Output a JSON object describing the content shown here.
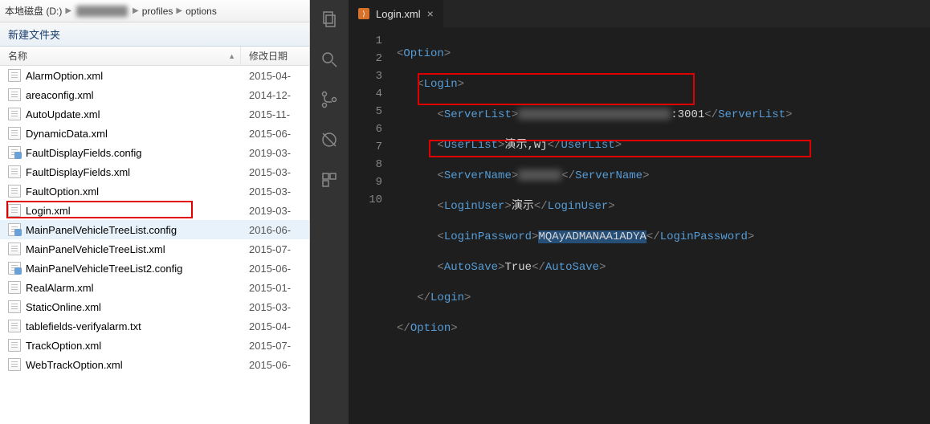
{
  "explorer": {
    "breadcrumb": {
      "drive": "本地磁盘 (D:)",
      "folder1": "profiles",
      "folder2": "options"
    },
    "toolbar_new_folder": "新建文件夹",
    "columns": {
      "name": "名称",
      "date": "修改日期"
    },
    "files": [
      {
        "name": "AlarmOption.xml",
        "date": "2015-04-",
        "icon": "xml"
      },
      {
        "name": "areaconfig.xml",
        "date": "2014-12-",
        "icon": "xml"
      },
      {
        "name": "AutoUpdate.xml",
        "date": "2015-11-",
        "icon": "xml"
      },
      {
        "name": "DynamicData.xml",
        "date": "2015-06-",
        "icon": "xml"
      },
      {
        "name": "FaultDisplayFields.config",
        "date": "2019-03-",
        "icon": "config"
      },
      {
        "name": "FaultDisplayFields.xml",
        "date": "2015-03-",
        "icon": "xml"
      },
      {
        "name": "FaultOption.xml",
        "date": "2015-03-",
        "icon": "xml"
      },
      {
        "name": "Login.xml",
        "date": "2019-03-",
        "icon": "xml",
        "highlighted": true
      },
      {
        "name": "MainPanelVehicleTreeList.config",
        "date": "2016-06-",
        "icon": "config",
        "hovered": true
      },
      {
        "name": "MainPanelVehicleTreeList.xml",
        "date": "2015-07-",
        "icon": "xml"
      },
      {
        "name": "MainPanelVehicleTreeList2.config",
        "date": "2015-06-",
        "icon": "config"
      },
      {
        "name": "RealAlarm.xml",
        "date": "2015-01-",
        "icon": "xml"
      },
      {
        "name": "StaticOnline.xml",
        "date": "2015-03-",
        "icon": "xml"
      },
      {
        "name": "tablefields-verifyalarm.txt",
        "date": "2015-04-",
        "icon": "xml"
      },
      {
        "name": "TrackOption.xml",
        "date": "2015-07-",
        "icon": "xml"
      },
      {
        "name": "WebTrackOption.xml",
        "date": "2015-06-",
        "icon": "xml"
      }
    ]
  },
  "editor": {
    "tab_name": "Login.xml",
    "xml": {
      "root_open": "Option",
      "login_open": "Login",
      "serverlist_tag": "ServerList",
      "serverlist_port": ":3001",
      "userlist_tag": "UserList",
      "userlist_value": "演示,wj",
      "servername_tag": "ServerName",
      "loginuser_tag": "LoginUser",
      "loginuser_value": "演示",
      "loginpassword_tag": "LoginPassword",
      "loginpassword_value": "MQAyADMANAA1ADYA",
      "autosave_tag": "AutoSave",
      "autosave_value": "True"
    }
  }
}
